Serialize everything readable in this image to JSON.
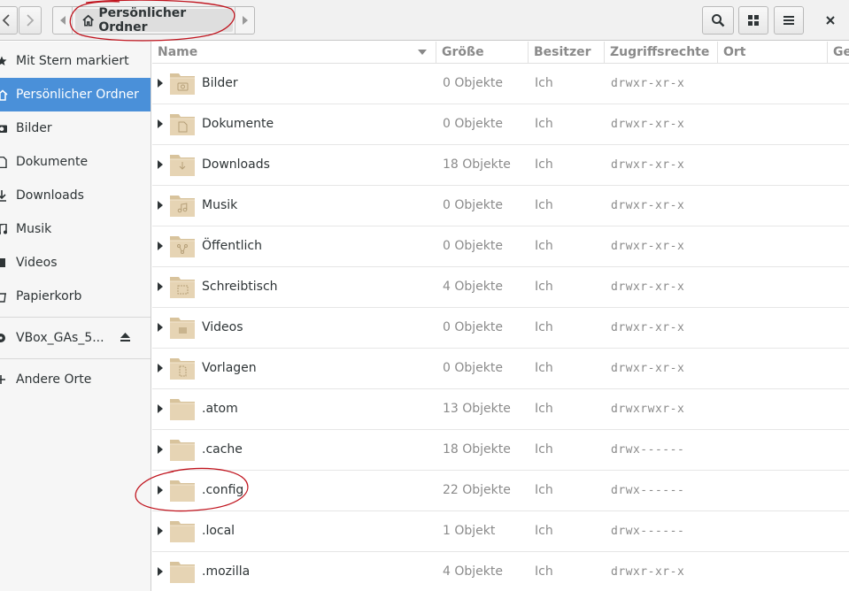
{
  "header": {
    "back_icon": "chevron-left-icon",
    "forward_icon": "chevron-right-icon",
    "path": {
      "scroll_left_icon": "triangle-left-icon",
      "scroll_right_icon": "triangle-right-icon",
      "current_folder_icon": "home-icon",
      "current_folder": "Persönlicher Ordner"
    },
    "search_icon": "search-icon",
    "view_toggle_icon": "grid-icon",
    "menu_icon": "hamburger-icon",
    "close_icon": "close-icon"
  },
  "sidebar": {
    "items": [
      {
        "label": "Mit Stern markiert",
        "icon": "star-icon"
      },
      {
        "label": "Persönlicher Ordner",
        "icon": "home-icon",
        "active": true
      },
      {
        "label": "Bilder",
        "icon": "camera-icon"
      },
      {
        "label": "Dokumente",
        "icon": "document-icon"
      },
      {
        "label": "Downloads",
        "icon": "download-icon"
      },
      {
        "label": "Musik",
        "icon": "music-icon"
      },
      {
        "label": "Videos",
        "icon": "video-icon"
      },
      {
        "label": "Papierkorb",
        "icon": "trash-icon"
      },
      {
        "label": "VBox_GAs_5...",
        "icon": "disc-icon",
        "eject_icon": "eject-icon"
      },
      {
        "label": "Andere Orte",
        "icon": "plus-icon"
      }
    ]
  },
  "columns": {
    "name": "Name",
    "size": "Größe",
    "owner": "Besitzer",
    "permissions": "Zugriffsrechte",
    "location": "Ort",
    "more": "Ge"
  },
  "files": [
    {
      "name": "Bilder",
      "size": "0 Objekte",
      "owner": "Ich",
      "permissions": "drwxr-xr-x",
      "icon": "folder-pictures-icon"
    },
    {
      "name": "Dokumente",
      "size": "0 Objekte",
      "owner": "Ich",
      "permissions": "drwxr-xr-x",
      "icon": "folder-documents-icon"
    },
    {
      "name": "Downloads",
      "size": "18 Objekte",
      "owner": "Ich",
      "permissions": "drwxr-xr-x",
      "icon": "folder-download-icon"
    },
    {
      "name": "Musik",
      "size": "0 Objekte",
      "owner": "Ich",
      "permissions": "drwxr-xr-x",
      "icon": "folder-music-icon"
    },
    {
      "name": "Öffentlich",
      "size": "0 Objekte",
      "owner": "Ich",
      "permissions": "drwxr-xr-x",
      "icon": "folder-publicshare-icon"
    },
    {
      "name": "Schreibtisch",
      "size": "4 Objekte",
      "owner": "Ich",
      "permissions": "drwxr-xr-x",
      "icon": "folder-desktop-icon"
    },
    {
      "name": "Videos",
      "size": "0 Objekte",
      "owner": "Ich",
      "permissions": "drwxr-xr-x",
      "icon": "folder-videos-icon"
    },
    {
      "name": "Vorlagen",
      "size": "0 Objekte",
      "owner": "Ich",
      "permissions": "drwxr-xr-x",
      "icon": "folder-templates-icon"
    },
    {
      "name": ".atom",
      "size": "13 Objekte",
      "owner": "Ich",
      "permissions": "drwxrwxr-x",
      "icon": "folder-icon"
    },
    {
      "name": ".cache",
      "size": "18 Objekte",
      "owner": "Ich",
      "permissions": "drwx------",
      "icon": "folder-icon"
    },
    {
      "name": ".config",
      "size": "22 Objekte",
      "owner": "Ich",
      "permissions": "drwx------",
      "icon": "folder-icon"
    },
    {
      "name": ".local",
      "size": "1 Objekt",
      "owner": "Ich",
      "permissions": "drwx------",
      "icon": "folder-icon"
    },
    {
      "name": ".mozilla",
      "size": "4 Objekte",
      "owner": "Ich",
      "permissions": "drwxr-xr-x",
      "icon": "folder-icon"
    }
  ],
  "colors": {
    "accent": "#4a90d9",
    "folder": "#e6d4b4",
    "annotation": "#c0141e"
  }
}
